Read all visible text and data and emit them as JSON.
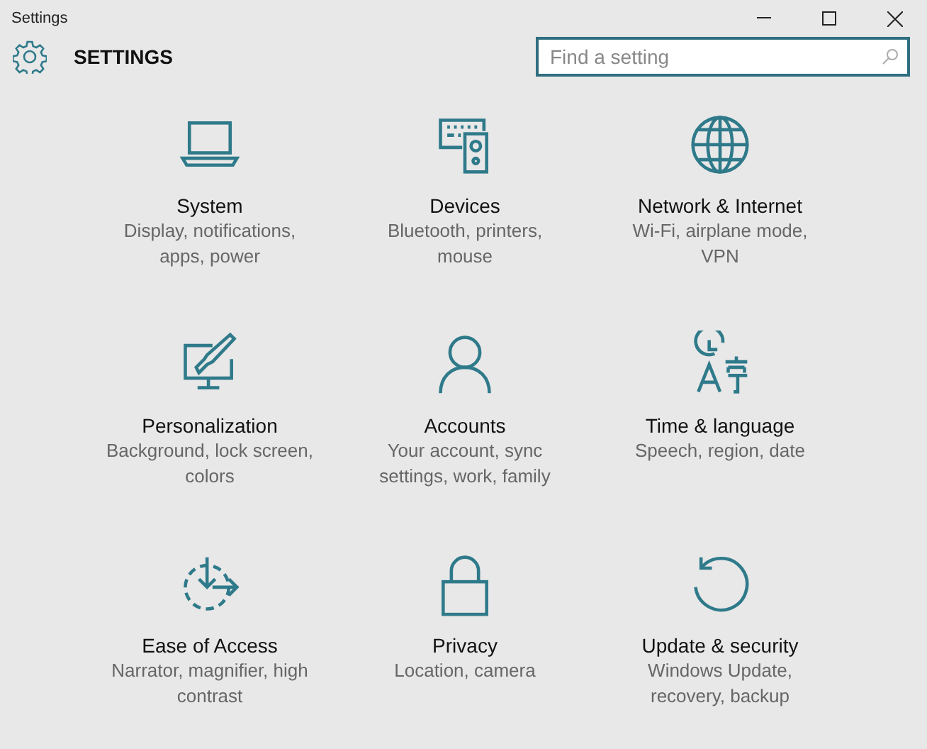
{
  "window": {
    "title": "Settings"
  },
  "header": {
    "title": "SETTINGS"
  },
  "search": {
    "placeholder": "Find a setting"
  },
  "categories": [
    {
      "kind": "laptop",
      "title": "System",
      "subtitle": "Display, notifications, apps, power"
    },
    {
      "kind": "devices",
      "title": "Devices",
      "subtitle": "Bluetooth, printers, mouse"
    },
    {
      "kind": "globe",
      "title": "Network & Internet",
      "subtitle": "Wi-Fi, airplane mode, VPN"
    },
    {
      "kind": "paint",
      "title": "Personalization",
      "subtitle": "Background, lock screen, colors"
    },
    {
      "kind": "person",
      "title": "Accounts",
      "subtitle": "Your account, sync settings, work, family"
    },
    {
      "kind": "time",
      "title": "Time & language",
      "subtitle": "Speech, region, date"
    },
    {
      "kind": "access",
      "title": "Ease of Access",
      "subtitle": "Narrator, magnifier, high contrast"
    },
    {
      "kind": "lock",
      "title": "Privacy",
      "subtitle": "Location, camera"
    },
    {
      "kind": "update",
      "title": "Update & security",
      "subtitle": "Windows Update, recovery, backup"
    }
  ]
}
